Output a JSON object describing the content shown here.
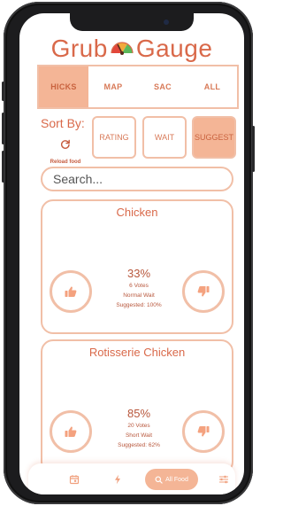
{
  "app": {
    "title_left": "Grub",
    "title_right": "Gauge"
  },
  "tabs": [
    {
      "label": "HICKS",
      "active": true
    },
    {
      "label": "MAP",
      "active": false
    },
    {
      "label": "SAC",
      "active": false
    },
    {
      "label": "ALL",
      "active": false
    }
  ],
  "sort": {
    "label": "Sort By:",
    "reload_label": "Reload food",
    "buttons": [
      {
        "label": "RATING",
        "active": false
      },
      {
        "label": "WAIT",
        "active": false
      },
      {
        "label": "SUGGEST",
        "active": true
      }
    ]
  },
  "search": {
    "placeholder": "Search..."
  },
  "foods": [
    {
      "name": "Chicken",
      "percent": "33%",
      "votes": "6 Votes",
      "wait": "Normal Wait",
      "suggested": "Suggested: 100%"
    },
    {
      "name": "Rotisserie Chicken",
      "percent": "85%",
      "votes": "20 Votes",
      "wait": "Short Wait",
      "suggested": "Suggested: 62%"
    }
  ],
  "bottom_nav": {
    "items": [
      {
        "icon": "calendar-icon"
      },
      {
        "icon": "lightning-icon"
      },
      {
        "icon": "search-icon",
        "label": "All Food",
        "active": true
      },
      {
        "icon": "sliders-icon"
      }
    ]
  },
  "colors": {
    "accent": "#d9694a",
    "accent_light": "#f4b596",
    "border": "#f1bfa7"
  }
}
